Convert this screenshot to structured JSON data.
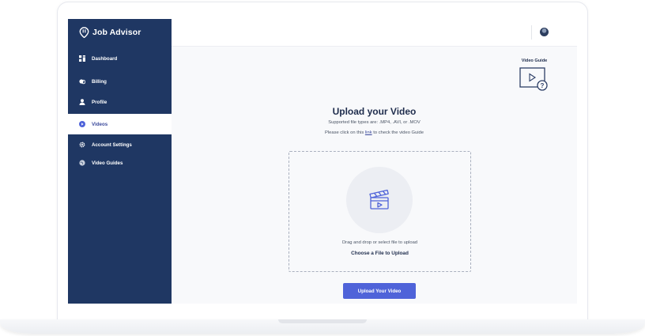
{
  "app": {
    "brand": "Job Advisor"
  },
  "sidebar": {
    "items": [
      {
        "label": "Dashboard",
        "icon": "dashboard-icon",
        "active": false
      },
      {
        "label": "Billing",
        "icon": "billing-icon",
        "active": false
      },
      {
        "label": "Profile",
        "icon": "user-icon",
        "active": false
      },
      {
        "label": "Videos",
        "icon": "play-circle-icon",
        "active": true
      },
      {
        "label": "Account Settings",
        "icon": "gear-icon",
        "active": false
      },
      {
        "label": "Video Guides",
        "icon": "globe-icon",
        "active": false
      }
    ]
  },
  "guide": {
    "label": "Video Guide",
    "icon": "video-help-icon"
  },
  "upload": {
    "title": "Upload your Video",
    "supported": "Supported file types are:  .MP4, .AVI, or .MOV",
    "help_prefix": "Please click on this ",
    "help_link": "link",
    "help_suffix": " to check the video Guide",
    "drop_text": "Drag and drop or select file to upload",
    "choose_label": "Choose a File to Upload",
    "button_label": "Upload Your Video"
  },
  "colors": {
    "sidebar": "#1f3763",
    "accent": "#4f63d9",
    "active_text": "#3b4a9c",
    "title": "#1f2d4d"
  }
}
